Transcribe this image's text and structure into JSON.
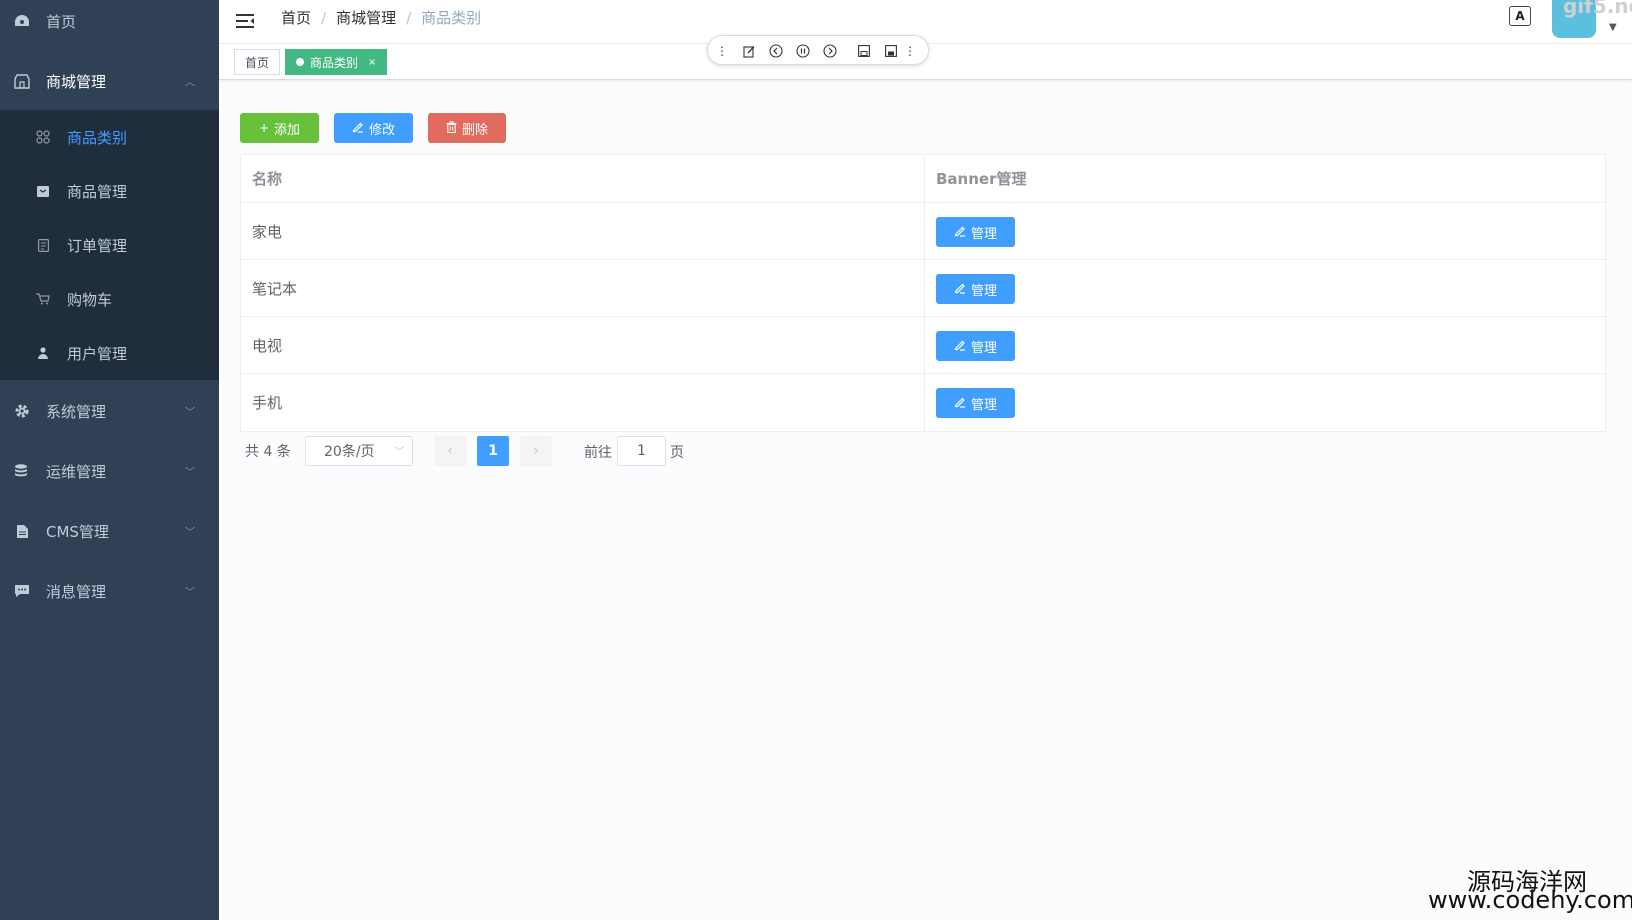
{
  "sidebar": {
    "home": "首页",
    "mall": "商城管理",
    "sub": [
      {
        "label": "商品类别",
        "icon": "grid-icon"
      },
      {
        "label": "商品管理",
        "icon": "box-icon"
      },
      {
        "label": "订单管理",
        "icon": "document-icon"
      },
      {
        "label": "购物车",
        "icon": "cart-icon"
      },
      {
        "label": "用户管理",
        "icon": "user-icon"
      }
    ],
    "system": "系统管理",
    "ops": "运维管理",
    "cms": "CMS管理",
    "msg": "消息管理"
  },
  "header": {
    "breadcrumb": [
      "首页",
      "商城管理",
      "商品类别"
    ],
    "separator": "/",
    "translate_label": "A",
    "watermark": "gif5.ne"
  },
  "tags": {
    "home": "首页",
    "active": "商品类别",
    "close": "×"
  },
  "toolbar": {
    "add": "添加",
    "edit": "修改",
    "delete": "删除",
    "add_icon": "+"
  },
  "table": {
    "headers": [
      "名称",
      "Banner管理"
    ],
    "rows": [
      "家电",
      "笔记本",
      "电视",
      "手机"
    ],
    "manage_label": "管理"
  },
  "pagination": {
    "total": "共 4 条",
    "page_size": "20条/页",
    "current": "1",
    "goto": "前往",
    "goto_value": "1",
    "page_unit": "页",
    "prev": "‹",
    "next": "›"
  },
  "watermark": {
    "line1": "源码海洋网",
    "line2": "www.codehy.com"
  },
  "colors": {
    "sidebar_bg": "#304156",
    "submenu_bg": "#1f2d3d",
    "active_text": "#409eff",
    "tag_active": "#42b983",
    "add": "#67c23a",
    "primary": "#409eff",
    "danger": "#e06b5e"
  }
}
